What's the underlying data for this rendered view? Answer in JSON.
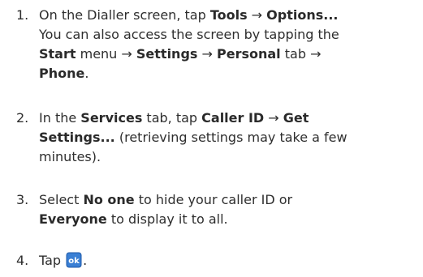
{
  "steps": [
    {
      "number": "1.",
      "parts": [
        {
          "t": "On the Dialler screen, tap ",
          "b": false
        },
        {
          "t": "Tools",
          "b": true
        },
        {
          "t": " → ",
          "b": false
        },
        {
          "t": "Options...",
          "b": true
        },
        {
          "t": "You can also access the screen by tapping the ",
          "b": false,
          "br": true
        },
        {
          "t": "Start",
          "b": true,
          "br": true
        },
        {
          "t": " menu → ",
          "b": false
        },
        {
          "t": "Settings",
          "b": true
        },
        {
          "t": " → ",
          "b": false
        },
        {
          "t": "Personal",
          "b": true
        },
        {
          "t": " tab →",
          "b": false
        },
        {
          "t": "Phone",
          "b": true,
          "br": true
        },
        {
          "t": ".",
          "b": false
        }
      ]
    },
    {
      "number": "2.",
      "parts": [
        {
          "t": "In the ",
          "b": false
        },
        {
          "t": "Services",
          "b": true
        },
        {
          "t": " tab, tap ",
          "b": false
        },
        {
          "t": "Caller ID",
          "b": true
        },
        {
          "t": " → ",
          "b": false
        },
        {
          "t": "Get",
          "b": true
        },
        {
          "t": "Settings...",
          "b": true,
          "br": true
        },
        {
          "t": " (retrieving settings may take a few",
          "b": false
        },
        {
          "t": "minutes).",
          "b": false,
          "br": true
        }
      ]
    },
    {
      "number": "3.",
      "parts": [
        {
          "t": "Select ",
          "b": false
        },
        {
          "t": "No one",
          "b": true
        },
        {
          "t": " to hide your caller ID or",
          "b": false
        },
        {
          "t": "Everyone",
          "b": true,
          "br": true
        },
        {
          "t": " to display it to all.",
          "b": false
        }
      ]
    },
    {
      "number": "4.",
      "parts": [
        {
          "t": "Tap ",
          "b": false
        },
        {
          "icon": "ok-icon"
        },
        {
          "t": ".",
          "b": false
        }
      ]
    }
  ],
  "colors": {
    "text": "#2e2e2e",
    "ok_icon_bg": "#3a7fd4"
  }
}
